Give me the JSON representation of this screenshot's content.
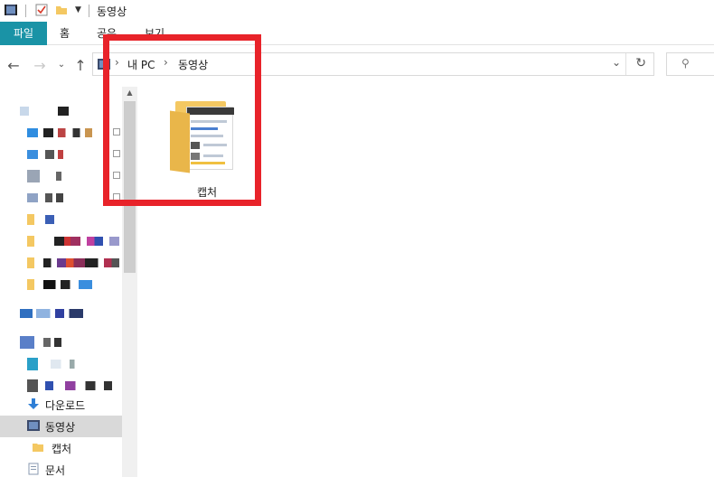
{
  "window": {
    "title": "동영상"
  },
  "ribbon": {
    "tabs": [
      {
        "label": "파일"
      },
      {
        "label": "홈"
      },
      {
        "label": "공유"
      },
      {
        "label": "보기"
      }
    ]
  },
  "address_bar": {
    "crumbs": [
      "내 PC",
      "동영상"
    ],
    "separator": "›"
  },
  "search": {
    "icon": "search-icon"
  },
  "nav_pane": {
    "items": [
      {
        "label": "다운로드",
        "icon": "download-arrow-icon"
      },
      {
        "label": "동영상",
        "icon": "video-folder-icon",
        "selected": true
      },
      {
        "label": "캡처",
        "icon": "folder-icon"
      },
      {
        "label": "문서",
        "icon": "documents-icon"
      }
    ]
  },
  "content": {
    "items": [
      {
        "label": "캡처",
        "icon": "folder-with-preview-icon"
      }
    ]
  },
  "colors": {
    "accent": "#1a93a6",
    "selection": "#d9d9d9",
    "highlight_box": "#e8232a",
    "folder": "#f4c862"
  }
}
